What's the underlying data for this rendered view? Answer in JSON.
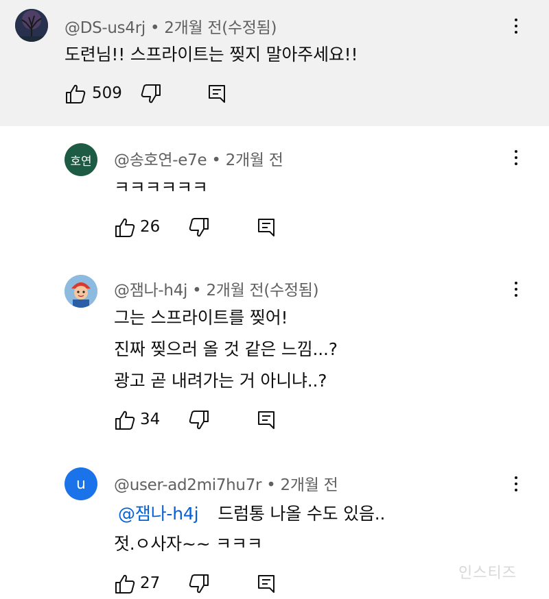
{
  "comments": [
    {
      "author": "@DS-us4rj",
      "separator": "•",
      "time": "2개월 전(수정됨)",
      "lines": [
        "도련님!! 스프라이트는 찢지 말아주세요!!"
      ],
      "likes": "509"
    },
    {
      "avatar_text": "호연",
      "avatar_color": "#1e5b45",
      "author": "@송호연-e7e",
      "separator": "•",
      "time": "2개월 전",
      "lines": [
        "ㅋㅋㅋㅋㅋㅋ"
      ],
      "likes": "26"
    },
    {
      "author": "@잼나-h4j",
      "separator": "•",
      "time": "2개월 전(수정됨)",
      "lines": [
        "그는 스프라이트를 찢어!",
        "진짜 찢으러 올 것 같은 느낌...?",
        "광고 곧 내려가는 거 아니냐..?"
      ],
      "likes": "34"
    },
    {
      "avatar_text": "u",
      "avatar_color": "#1a73e8",
      "author": "@user-ad2mi7hu7r",
      "separator": "•",
      "time": "2개월 전",
      "mention": "@잼나-h4j",
      "lines": [
        "드럼통 나올 수도 있음..",
        "젓.ㅇ사자~~ ㅋㅋㅋ"
      ],
      "likes": "27"
    }
  ],
  "icons": {
    "like": "thumbs-up-icon",
    "dislike": "thumbs-down-icon",
    "reply": "reply-icon",
    "more": "more-vertical-icon"
  },
  "watermark": "인스티즈"
}
